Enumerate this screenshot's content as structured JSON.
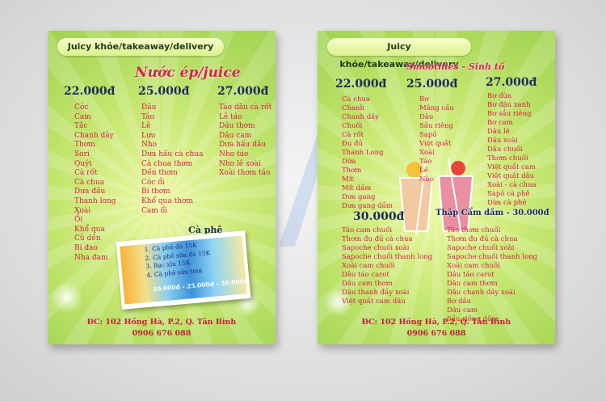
{
  "left": {
    "header": "Juicy khỏe/takeaway/delivery",
    "title": "Nước ép/juice",
    "prices": [
      "22.000đ",
      "25.000đ",
      "27.000đ"
    ],
    "col1": [
      "Cóc",
      "Cam",
      "Tắc",
      "Chanh dây",
      "Thơm",
      "Sori",
      "Quýt",
      "Cà rốt",
      "Cà chua",
      "Dưa đầu",
      "Thanh long",
      "Xoài",
      "Ổi",
      "Khổ qua",
      "Củ dền",
      "Bí đao",
      "Nha đam"
    ],
    "col2": [
      "Dâu",
      "Táo",
      "Lê",
      "Lựu",
      "Nho",
      "Dưa hấu cà chua",
      "Cà chua thơm",
      "Dền thơm",
      "Cóc ổi",
      "Bí thơm",
      "Khổ qua thơm",
      "Cam ổi"
    ],
    "col3": [
      "Táo dâu cà rốt",
      "Lê táo",
      "Dâu thơm",
      "Dâu cam",
      "Dưa hấu dâu",
      "Nho táo",
      "Nho lê xoài",
      "Xoài thơm táo"
    ],
    "cafe_title": "Cà phê",
    "cafe_items": [
      "1. Cà phê đá 15K",
      "2. Cà phê sữa đá 15K",
      "3. Bạc xỉu 15K",
      "4. Cà phê sữa tươi"
    ],
    "cafe_price": "20.000đ - 25.000đ - 30.000đ",
    "address": "ĐC: 102 Hồng Hà, P.2, Q. Tân Bình",
    "phone": "0906 676 088"
  },
  "right": {
    "header": "Juicy khỏe/takeaway/delivery",
    "title": "Smoothies - Sinh tố",
    "prices": [
      "22.000đ",
      "25.000đ",
      "27.000đ"
    ],
    "col1": [
      "Cà chua",
      "Chanh",
      "Chanh dây",
      "Chuối",
      "Cà rốt",
      "Đu đủ",
      "Thanh Long",
      "Dứa",
      "Thơm",
      "Mít",
      "Mít dầm",
      "Dưa gang",
      "Dưa gang dầm"
    ],
    "col2": [
      "Bơ",
      "Mãng cầu",
      "Dâu",
      "Sầu riêng",
      "Sapô",
      "Việt quất",
      "Xoài",
      "Táo",
      "Lê",
      "Nho"
    ],
    "col3": [
      "Bơ dừa",
      "Bơ đậu xanh",
      "Bơ sầu riêng",
      "Bơ cam",
      "Dâu lê",
      "Dâu xoài",
      "Dâu chuối",
      "Thơm chuối",
      "Việt quất cam",
      "Việt quất dâu",
      "Xoài - cà chua",
      "Sapô cà phê",
      "Dừa cà phê"
    ],
    "price_30": "30.000đ",
    "mix_title": "Thập Cẩm dầm - 30.000đ",
    "col4": [
      "Táo cam chuối",
      "Thơm đu đủ cà chua",
      "Sapoche chuối xoài",
      "Sapoche chuối thanh long",
      "Xoài cam chuối",
      "Dâu táo carot",
      "Dâu cam thơm",
      "Dâu thanh đầy xoài",
      "Việt quất cam dâu"
    ],
    "col5": [
      "Táo thơm chuối",
      "Thơm đu đủ cà chua",
      "Sapoche chuối xoài",
      "Sapoche chuối thanh long",
      "Xoài cam chuối",
      "Dâu táo carot",
      "Dâu cam thơm",
      "Dâu chanh dây xoài",
      "Bơ dâu",
      "Dâu cam",
      "Sầu riêng dâm"
    ],
    "address": "ĐC: 102 Hồng Hà, P.2, Q. Tân Bình",
    "phone": "0906 676 088"
  }
}
